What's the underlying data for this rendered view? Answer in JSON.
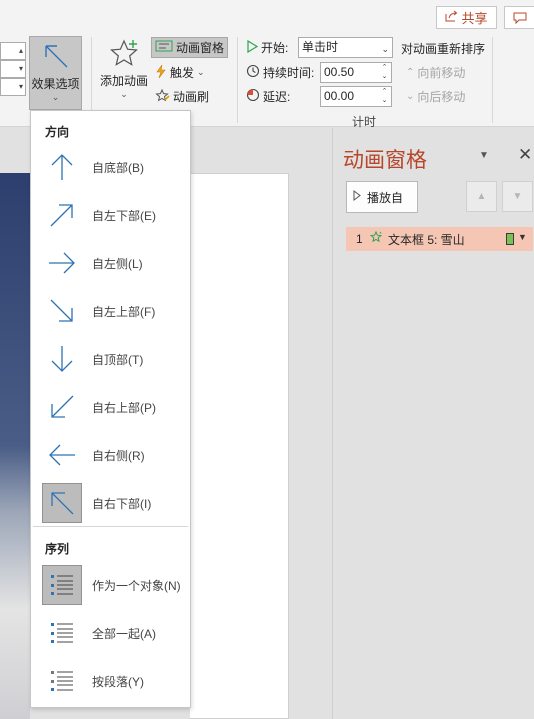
{
  "top": {
    "share_label": "共享",
    "share_icon": "share-icon",
    "comment_icon": "comment-icon"
  },
  "ribbon": {
    "effects_options_label": "效果选项",
    "add_animation_label": "添加动画",
    "animation_pane_label": "动画窗格",
    "trigger_label": "触发",
    "animation_painter_label": "动画刷",
    "start_label": "开始:",
    "start_value": "单击时",
    "duration_label": "持续时间:",
    "duration_value": "00.50",
    "delay_label": "延迟:",
    "delay_value": "00.00",
    "timing_group_label": "计时",
    "reorder_label": "对动画重新排序",
    "move_earlier_label": "向前移动",
    "move_later_label": "向后移动"
  },
  "menu": {
    "direction_header": "方向",
    "sequence_header": "序列",
    "direction_items": [
      {
        "label": "自底部(B)",
        "icon": "arrow-up-icon",
        "selected": false
      },
      {
        "label": "自左下部(E)",
        "icon": "arrow-up-right-icon",
        "selected": false
      },
      {
        "label": "自左侧(L)",
        "icon": "arrow-right-icon",
        "selected": false
      },
      {
        "label": "自左上部(F)",
        "icon": "arrow-down-right-icon",
        "selected": false
      },
      {
        "label": "自顶部(T)",
        "icon": "arrow-down-icon",
        "selected": false
      },
      {
        "label": "自右上部(P)",
        "icon": "arrow-down-left-icon",
        "selected": false
      },
      {
        "label": "自右侧(R)",
        "icon": "arrow-left-icon",
        "selected": false
      },
      {
        "label": "自右下部(I)",
        "icon": "arrow-up-left-icon",
        "selected": true
      }
    ],
    "sequence_items": [
      {
        "label": "作为一个对象(N)",
        "icon": "sequence-as-one-object-icon",
        "selected": true
      },
      {
        "label": "全部一起(A)",
        "icon": "sequence-all-at-once-icon",
        "selected": false
      },
      {
        "label": "按段落(Y)",
        "icon": "sequence-by-paragraph-icon",
        "selected": false
      }
    ]
  },
  "pane": {
    "title": "动画窗格",
    "play_label": "播放自",
    "item_number": "1",
    "item_label": "文本框 5: 雪山",
    "item_timing_color": "#7bbf59",
    "accent_color": "#b7472a"
  }
}
